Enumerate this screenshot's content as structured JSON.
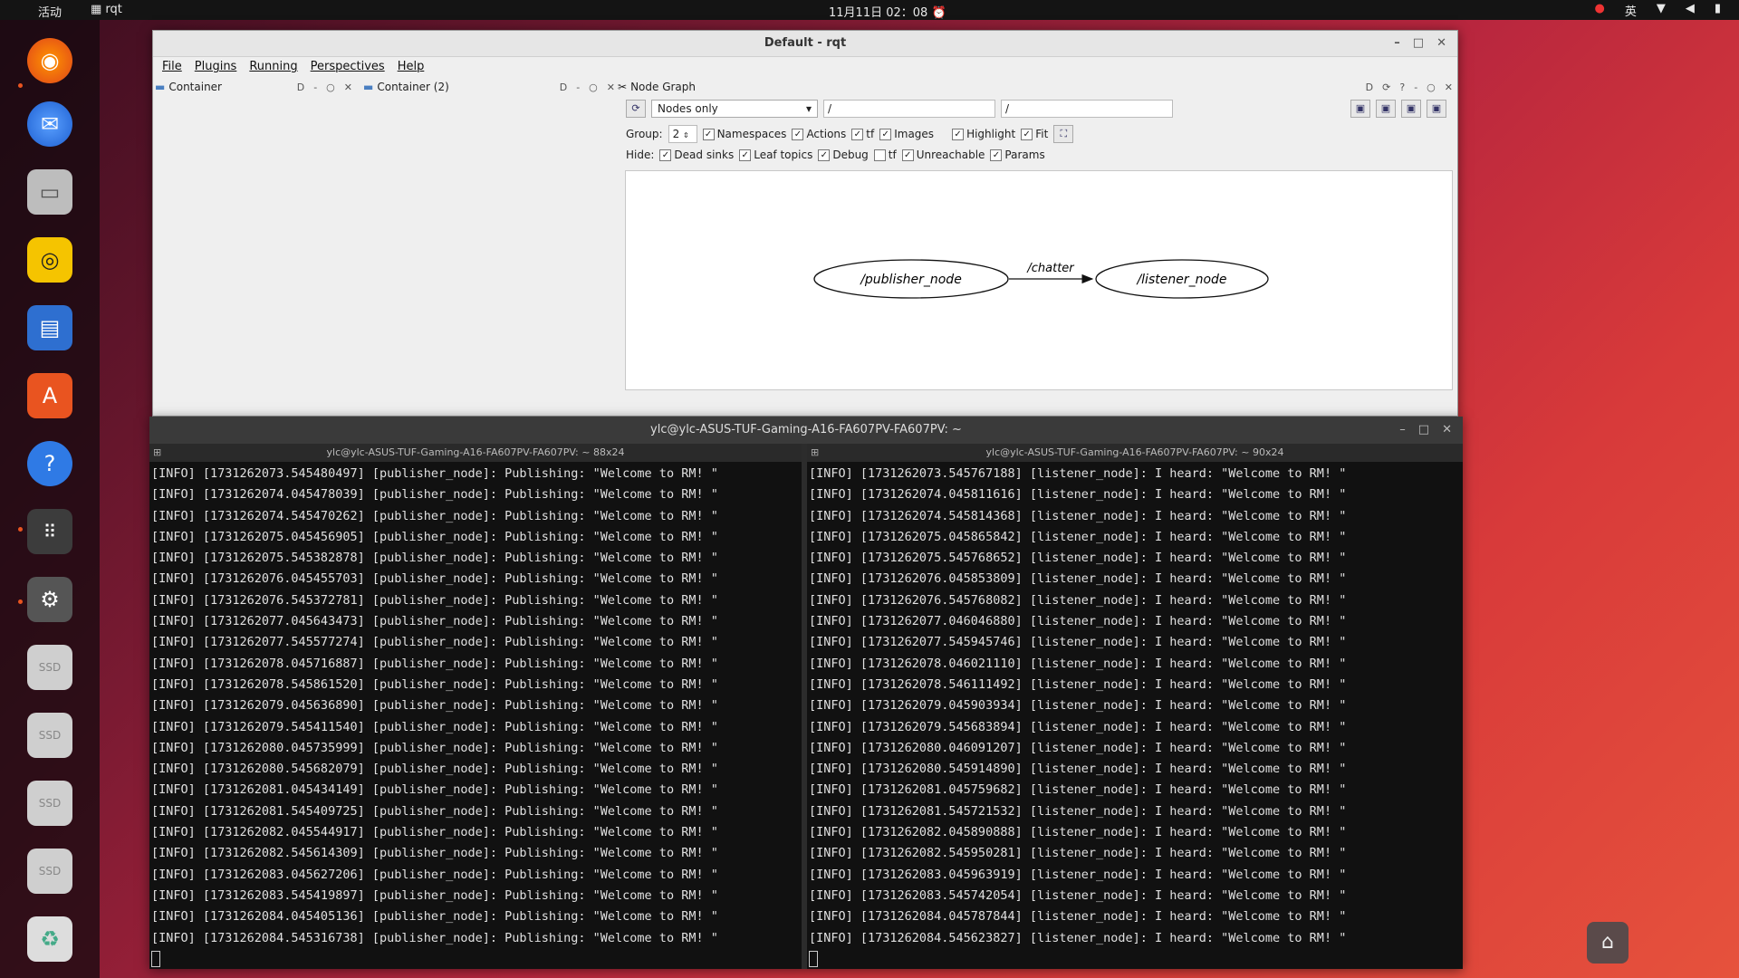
{
  "topbar": {
    "activities": "活动",
    "app": "rqt",
    "clock": "11月11日 02：08",
    "lang": "英"
  },
  "dock": {
    "icons": [
      "firefox-icon",
      "thunderbird-icon",
      "files-icon",
      "rhythmbox-icon",
      "writer-icon",
      "app-center-icon",
      "help-icon",
      "app-grid-icon",
      "settings-icon",
      "ssd-drive-icon",
      "ssd-drive-icon",
      "ssd-drive-icon",
      "ssd-drive-icon",
      "trash-icon"
    ],
    "ssd_label": "SSD"
  },
  "rqt": {
    "title": "Default - rqt",
    "menu": [
      "File",
      "Plugins",
      "Running",
      "Perspectives",
      "Help"
    ],
    "left_dock_title": "Container",
    "mid_dock_title": "Container (2)",
    "node_graph_title": "Node Graph",
    "dock_d": "D",
    "filter_select": "Nodes only",
    "ns_filter": "/",
    "topic_filter": "/",
    "group_label": "Group:",
    "group_value": "2",
    "opts": {
      "namespaces": "Namespaces",
      "actions": "Actions",
      "tf": "tf",
      "images": "Images",
      "highlight": "Highlight",
      "fit": "Fit"
    },
    "hide_label": "Hide:",
    "hide": {
      "dead_sinks": "Dead sinks",
      "leaf_topics": "Leaf topics",
      "debug": "Debug",
      "tf": "tf",
      "unreachable": "Unreachable",
      "params": "Params"
    },
    "graph": {
      "publisher": "/publisher_node",
      "topic": "/chatter",
      "listener": "/listener_node"
    }
  },
  "terminal": {
    "title": "ylc@ylc-ASUS-TUF-Gaming-A16-FA607PV-FA607PV: ~",
    "left_pane_title": "ylc@ylc-ASUS-TUF-Gaming-A16-FA607PV-FA607PV: ~ 88x24",
    "right_pane_title": "ylc@ylc-ASUS-TUF-Gaming-A16-FA607PV-FA607PV: ~ 90x24",
    "left_lines": [
      "[INFO] [1731262073.545480497] [publisher_node]: Publishing: \"Welcome to RM! \"",
      "[INFO] [1731262074.045478039] [publisher_node]: Publishing: \"Welcome to RM! \"",
      "[INFO] [1731262074.545470262] [publisher_node]: Publishing: \"Welcome to RM! \"",
      "[INFO] [1731262075.045456905] [publisher_node]: Publishing: \"Welcome to RM! \"",
      "[INFO] [1731262075.545382878] [publisher_node]: Publishing: \"Welcome to RM! \"",
      "[INFO] [1731262076.045455703] [publisher_node]: Publishing: \"Welcome to RM! \"",
      "[INFO] [1731262076.545372781] [publisher_node]: Publishing: \"Welcome to RM! \"",
      "[INFO] [1731262077.045643473] [publisher_node]: Publishing: \"Welcome to RM! \"",
      "[INFO] [1731262077.545577274] [publisher_node]: Publishing: \"Welcome to RM! \"",
      "[INFO] [1731262078.045716887] [publisher_node]: Publishing: \"Welcome to RM! \"",
      "[INFO] [1731262078.545861520] [publisher_node]: Publishing: \"Welcome to RM! \"",
      "[INFO] [1731262079.045636890] [publisher_node]: Publishing: \"Welcome to RM! \"",
      "[INFO] [1731262079.545411540] [publisher_node]: Publishing: \"Welcome to RM! \"",
      "[INFO] [1731262080.045735999] [publisher_node]: Publishing: \"Welcome to RM! \"",
      "[INFO] [1731262080.545682079] [publisher_node]: Publishing: \"Welcome to RM! \"",
      "[INFO] [1731262081.045434149] [publisher_node]: Publishing: \"Welcome to RM! \"",
      "[INFO] [1731262081.545409725] [publisher_node]: Publishing: \"Welcome to RM! \"",
      "[INFO] [1731262082.045544917] [publisher_node]: Publishing: \"Welcome to RM! \"",
      "[INFO] [1731262082.545614309] [publisher_node]: Publishing: \"Welcome to RM! \"",
      "[INFO] [1731262083.045627206] [publisher_node]: Publishing: \"Welcome to RM! \"",
      "[INFO] [1731262083.545419897] [publisher_node]: Publishing: \"Welcome to RM! \"",
      "[INFO] [1731262084.045405136] [publisher_node]: Publishing: \"Welcome to RM! \"",
      "[INFO] [1731262084.545316738] [publisher_node]: Publishing: \"Welcome to RM! \""
    ],
    "right_lines": [
      "[INFO] [1731262073.545767188] [listener_node]: I heard: \"Welcome to RM! \"",
      "[INFO] [1731262074.045811616] [listener_node]: I heard: \"Welcome to RM! \"",
      "[INFO] [1731262074.545814368] [listener_node]: I heard: \"Welcome to RM! \"",
      "[INFO] [1731262075.045865842] [listener_node]: I heard: \"Welcome to RM! \"",
      "[INFO] [1731262075.545768652] [listener_node]: I heard: \"Welcome to RM! \"",
      "[INFO] [1731262076.045853809] [listener_node]: I heard: \"Welcome to RM! \"",
      "[INFO] [1731262076.545768082] [listener_node]: I heard: \"Welcome to RM! \"",
      "[INFO] [1731262077.046046880] [listener_node]: I heard: \"Welcome to RM! \"",
      "[INFO] [1731262077.545945746] [listener_node]: I heard: \"Welcome to RM! \"",
      "[INFO] [1731262078.046021110] [listener_node]: I heard: \"Welcome to RM! \"",
      "[INFO] [1731262078.546111492] [listener_node]: I heard: \"Welcome to RM! \"",
      "[INFO] [1731262079.045903934] [listener_node]: I heard: \"Welcome to RM! \"",
      "[INFO] [1731262079.545683894] [listener_node]: I heard: \"Welcome to RM! \"",
      "[INFO] [1731262080.046091207] [listener_node]: I heard: \"Welcome to RM! \"",
      "[INFO] [1731262080.545914890] [listener_node]: I heard: \"Welcome to RM! \"",
      "[INFO] [1731262081.045759682] [listener_node]: I heard: \"Welcome to RM! \"",
      "[INFO] [1731262081.545721532] [listener_node]: I heard: \"Welcome to RM! \"",
      "[INFO] [1731262082.045890888] [listener_node]: I heard: \"Welcome to RM! \"",
      "[INFO] [1731262082.545950281] [listener_node]: I heard: \"Welcome to RM! \"",
      "[INFO] [1731262083.045963919] [listener_node]: I heard: \"Welcome to RM! \"",
      "[INFO] [1731262083.545742054] [listener_node]: I heard: \"Welcome to RM! \"",
      "[INFO] [1731262084.045787844] [listener_node]: I heard: \"Welcome to RM! \"",
      "[INFO] [1731262084.545623827] [listener_node]: I heard: \"Welcome to RM! \""
    ]
  }
}
